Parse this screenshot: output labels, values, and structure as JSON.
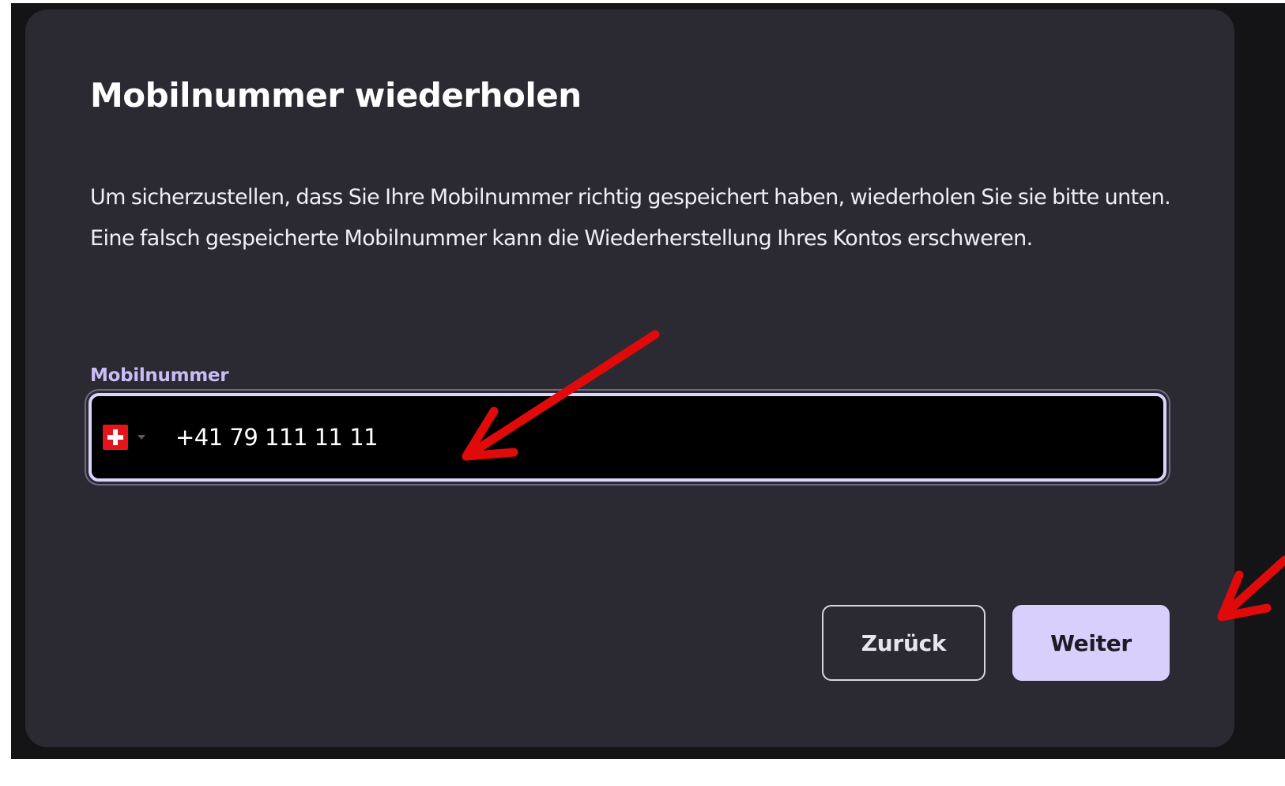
{
  "modal": {
    "title": "Mobilnummer wiederholen",
    "description": "Um sicherzustellen, dass Sie Ihre Mobilnummer richtig gespeichert haben, wiederholen Sie sie bitte unten. Eine falsch gespeicherte Mobilnummer kann die Wiederherstellung Ihres Kontos erschweren."
  },
  "phone_field": {
    "label": "Mobilnummer",
    "country_flag": "swiss-flag",
    "value": "+41 79 111 11 11"
  },
  "buttons": {
    "back_label": "Zurück",
    "next_label": "Weiter"
  },
  "colors": {
    "modal_background": "#2b2a33",
    "accent": "#d9cffc",
    "label": "#cbbcf6",
    "annotation_arrow": "#e10a0a"
  }
}
